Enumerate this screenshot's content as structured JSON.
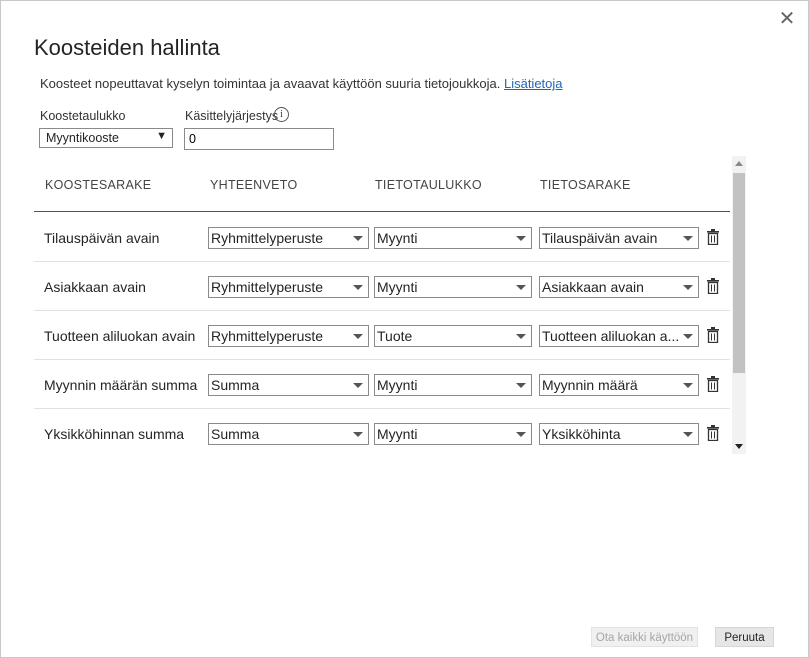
{
  "dialog": {
    "title": "Koosteiden hallinta",
    "description": "Koosteet nopeuttavat kyselyn toimintaa ja avaavat käyttöön suuria tietojoukkoja.",
    "learn_more": "Lisätietoja",
    "close_icon": "close-icon"
  },
  "fields": {
    "agg_table_label": "Koostetaulukko",
    "agg_table_value": "Myyntikooste",
    "precedence_label": "Käsittelyjärjestys",
    "precedence_value": "0",
    "info_icon": "i"
  },
  "table": {
    "headers": [
      "KOOSTESARAKE",
      "YHTEENVETO",
      "TIETOTAULUKKO",
      "TIETOSARAKE"
    ],
    "rows": [
      {
        "name": "Tilauspäivän avain",
        "summary": "Ryhmittelyperuste",
        "table": "Myynti",
        "column": "Tilauspäivän avain"
      },
      {
        "name": "Asiakkaan avain",
        "summary": "Ryhmittelyperuste",
        "table": "Myynti",
        "column": "Asiakkaan avain"
      },
      {
        "name": "Tuotteen aliluokan avain",
        "summary": "Ryhmittelyperuste",
        "table": "Tuote",
        "column": "Tuotteen aliluokan a..."
      },
      {
        "name": "Myynnin määrän summa",
        "summary": "Summa",
        "table": "Myynti",
        "column": "Myynnin määrä"
      },
      {
        "name": "Yksikköhinnan summa",
        "summary": "Summa",
        "table": "Myynti",
        "column": "Yksikköhinta"
      }
    ]
  },
  "footer": {
    "enable_all": "Ota kaikki käyttöön",
    "cancel": "Peruuta"
  },
  "colors": {
    "link": "#1f67b5",
    "disabled_text": "#a6a6a6"
  }
}
